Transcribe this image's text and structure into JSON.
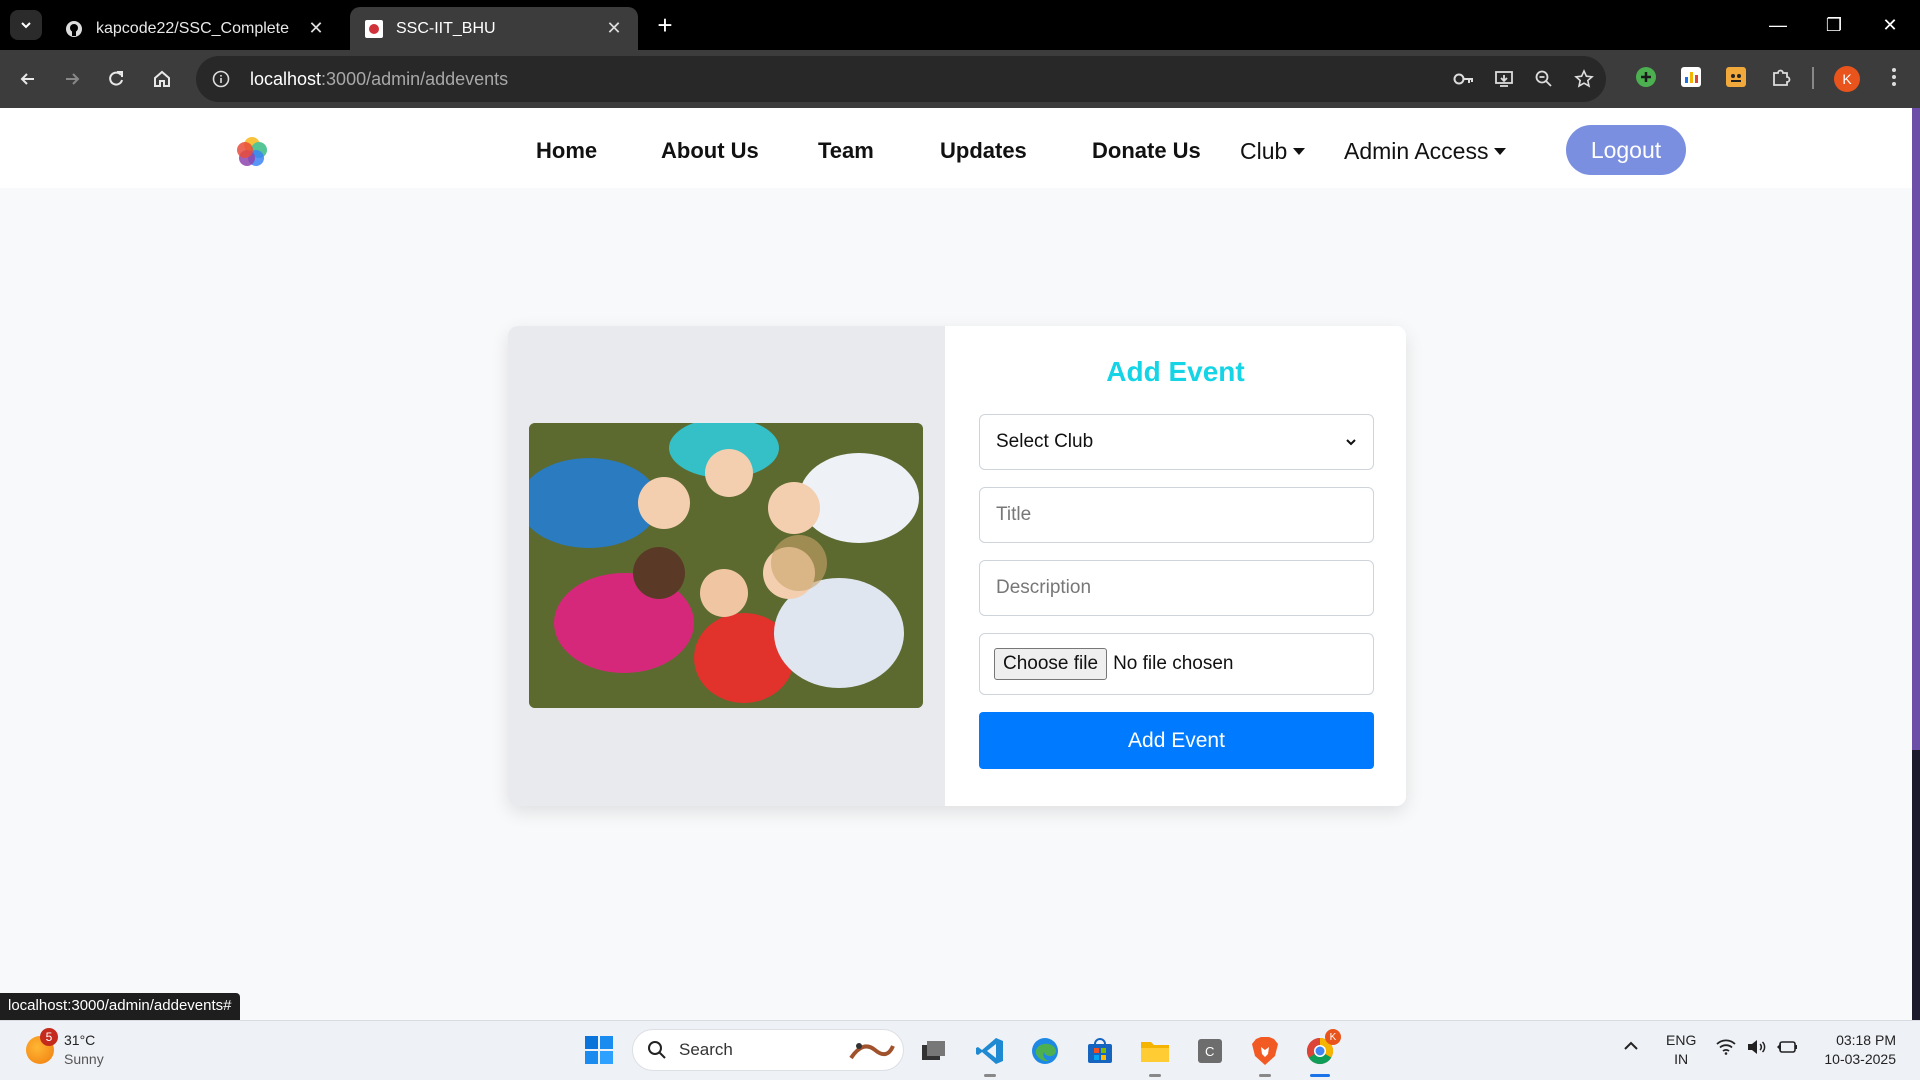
{
  "browser": {
    "tabs": [
      {
        "title": "kapcode22/SSC_Complete",
        "active": false
      },
      {
        "title": "SSC-IIT_BHU",
        "active": true
      }
    ],
    "url_host": "localhost",
    "url_path": ":3000/admin/addevents",
    "profile_initial": "K",
    "status_url": "localhost:3000/admin/addevents#"
  },
  "navbar": {
    "links": [
      "Home",
      "About Us",
      "Team",
      "Updates",
      "Donate Us"
    ],
    "dropdowns": [
      "Club",
      "Admin Access"
    ],
    "logout_label": "Logout"
  },
  "form": {
    "title": "Add Event",
    "select_placeholder": "Select Club",
    "title_placeholder": "Title",
    "description_placeholder": "Description",
    "file_button": "Choose file",
    "file_status": "No file chosen",
    "submit_label": "Add Event",
    "title_color": "#14d4e6",
    "submit_color": "#007bff"
  },
  "taskbar": {
    "weather_temp": "31°C",
    "weather_desc": "Sunny",
    "weather_badge": "5",
    "search_label": "Search",
    "language": "ENG",
    "region": "IN",
    "time": "03:18 PM",
    "date": "10-03-2025",
    "chrome_badge": "K"
  }
}
